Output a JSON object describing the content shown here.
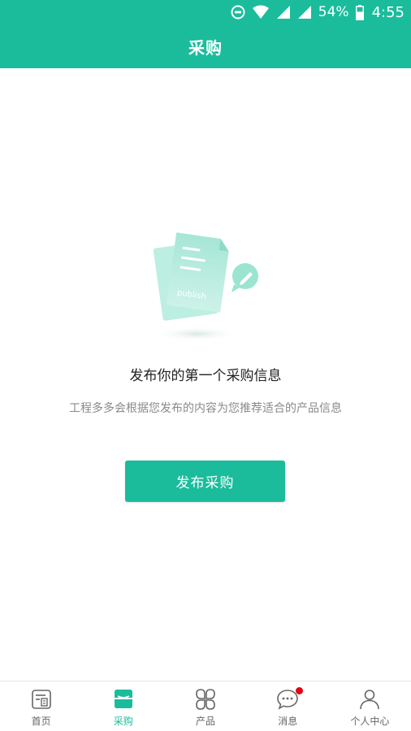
{
  "status_bar": {
    "battery": "54%",
    "time": "4:55"
  },
  "header": {
    "title": "采购"
  },
  "empty_state": {
    "illustration_text": "publish",
    "title": "发布你的第一个采购信息",
    "description": "工程多多会根据您发布的内容为您推荐适合的产品信息",
    "button_label": "发布采购"
  },
  "bottom_nav": {
    "items": [
      {
        "label": "首页",
        "icon": "home-icon"
      },
      {
        "label": "采购",
        "icon": "purchase-icon",
        "active": true
      },
      {
        "label": "产品",
        "icon": "product-icon"
      },
      {
        "label": "消息",
        "icon": "message-icon",
        "badge": true
      },
      {
        "label": "个人中心",
        "icon": "person-icon"
      }
    ]
  },
  "colors": {
    "accent": "#1abc9c",
    "badge": "#e60012"
  }
}
